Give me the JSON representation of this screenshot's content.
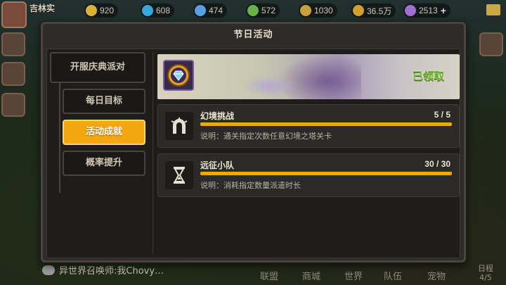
{
  "topbar": {
    "player_name": "吉林实",
    "resources": [
      {
        "value": "920",
        "icon": "gold-coin-icon",
        "color": "#d9b23a"
      },
      {
        "value": "608",
        "icon": "diamond-icon",
        "color": "#3aa5d9"
      },
      {
        "value": "474",
        "icon": "crystal-icon",
        "color": "#5aa0e0"
      },
      {
        "value": "572",
        "icon": "leaf-icon",
        "color": "#6ab04a"
      },
      {
        "value": "1030",
        "icon": "wheat-icon",
        "color": "#c8a040"
      },
      {
        "value": "36.5万",
        "icon": "coin-icon",
        "color": "#d0a030"
      },
      {
        "value": "2513",
        "icon": "gem-icon",
        "color": "#a070d0"
      }
    ],
    "plus": "+"
  },
  "modal": {
    "title": "节日活动",
    "tabs": {
      "first": "开服庆典派对",
      "items": [
        "每日目标",
        "活动成就",
        "概率提升"
      ],
      "active_index": 1
    },
    "banner": {
      "icon": "diamond-badge-icon",
      "status": "已领取"
    },
    "tasks": [
      {
        "name": "幻境挑战",
        "count": "5 / 5",
        "progress": 1.0,
        "desc": "说明：通关指定次数任意幻境之塔关卡",
        "icon": "horseshoe-gate-icon"
      },
      {
        "name": "远征小队",
        "count": "30 / 30",
        "progress": 1.0,
        "desc": "说明：消耗指定数量派遣时长",
        "icon": "hourglass-icon"
      }
    ]
  },
  "bottombar": {
    "chat": "异世界召唤师:我Chovy…",
    "nav": [
      "联盟",
      "商城",
      "世界",
      "队伍",
      "宠物"
    ],
    "schedule_label": "日程",
    "schedule_count": "4/5"
  }
}
